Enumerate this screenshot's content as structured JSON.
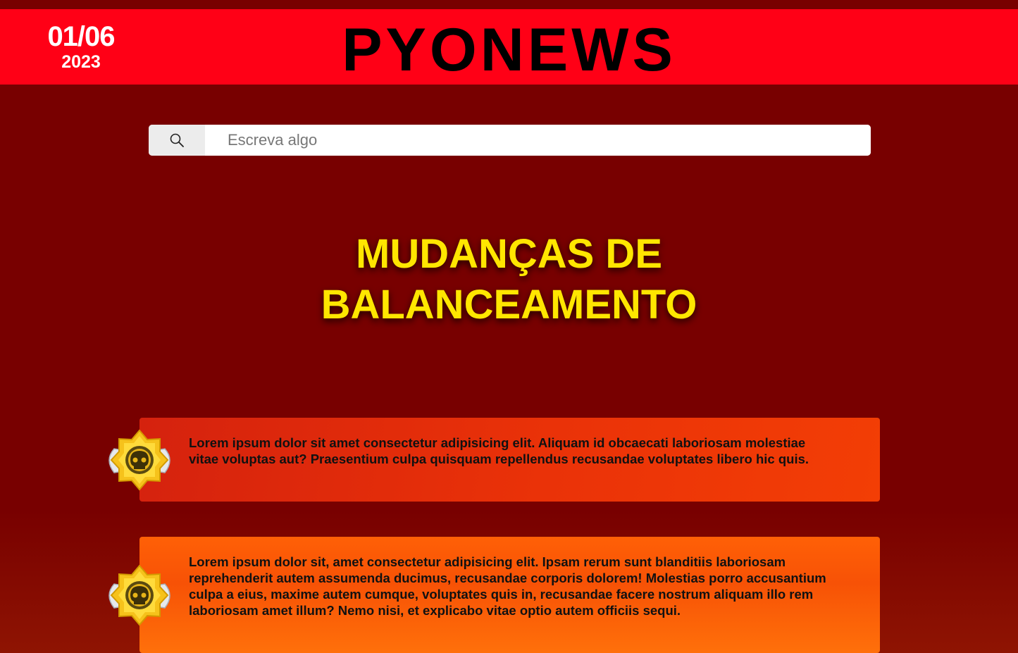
{
  "header": {
    "date_day": "01/06",
    "date_year": "2023",
    "brand": "PYONEWS",
    "brand_color": "#ff0016"
  },
  "search": {
    "placeholder": "Escreva algo",
    "icon": "search-icon"
  },
  "headline": {
    "line1": "MUDANÇAS DE",
    "line2": "BALANCEAMENTO",
    "color": "#ffe600"
  },
  "news": [
    {
      "icon": "star-badge-skull-icon",
      "text": "Lorem ipsum dolor sit amet consectetur adipisicing elit. Aliquam id obcaecati laboriosam molestiae vitae voluptas aut? Praesentium culpa quisquam repellendus recusandae voluptates libero hic quis."
    },
    {
      "icon": "star-badge-skull-icon",
      "text": "Lorem ipsum dolor sit, amet consectetur adipisicing elit. Ipsam rerum sunt blanditiis laboriosam reprehenderit autem assumenda ducimus, recusandae corporis dolorem! Molestias porro accusantium culpa a eius, maxime autem cumque, voluptates quis in, recusandae facere nostrum aliquam illo rem laboriosam amet illum? Nemo nisi, et explicabo vitae optio autem officiis sequi."
    }
  ],
  "colors": {
    "background": "#780000",
    "card_orange": "#ff6006",
    "card_red": "#d5220e"
  }
}
